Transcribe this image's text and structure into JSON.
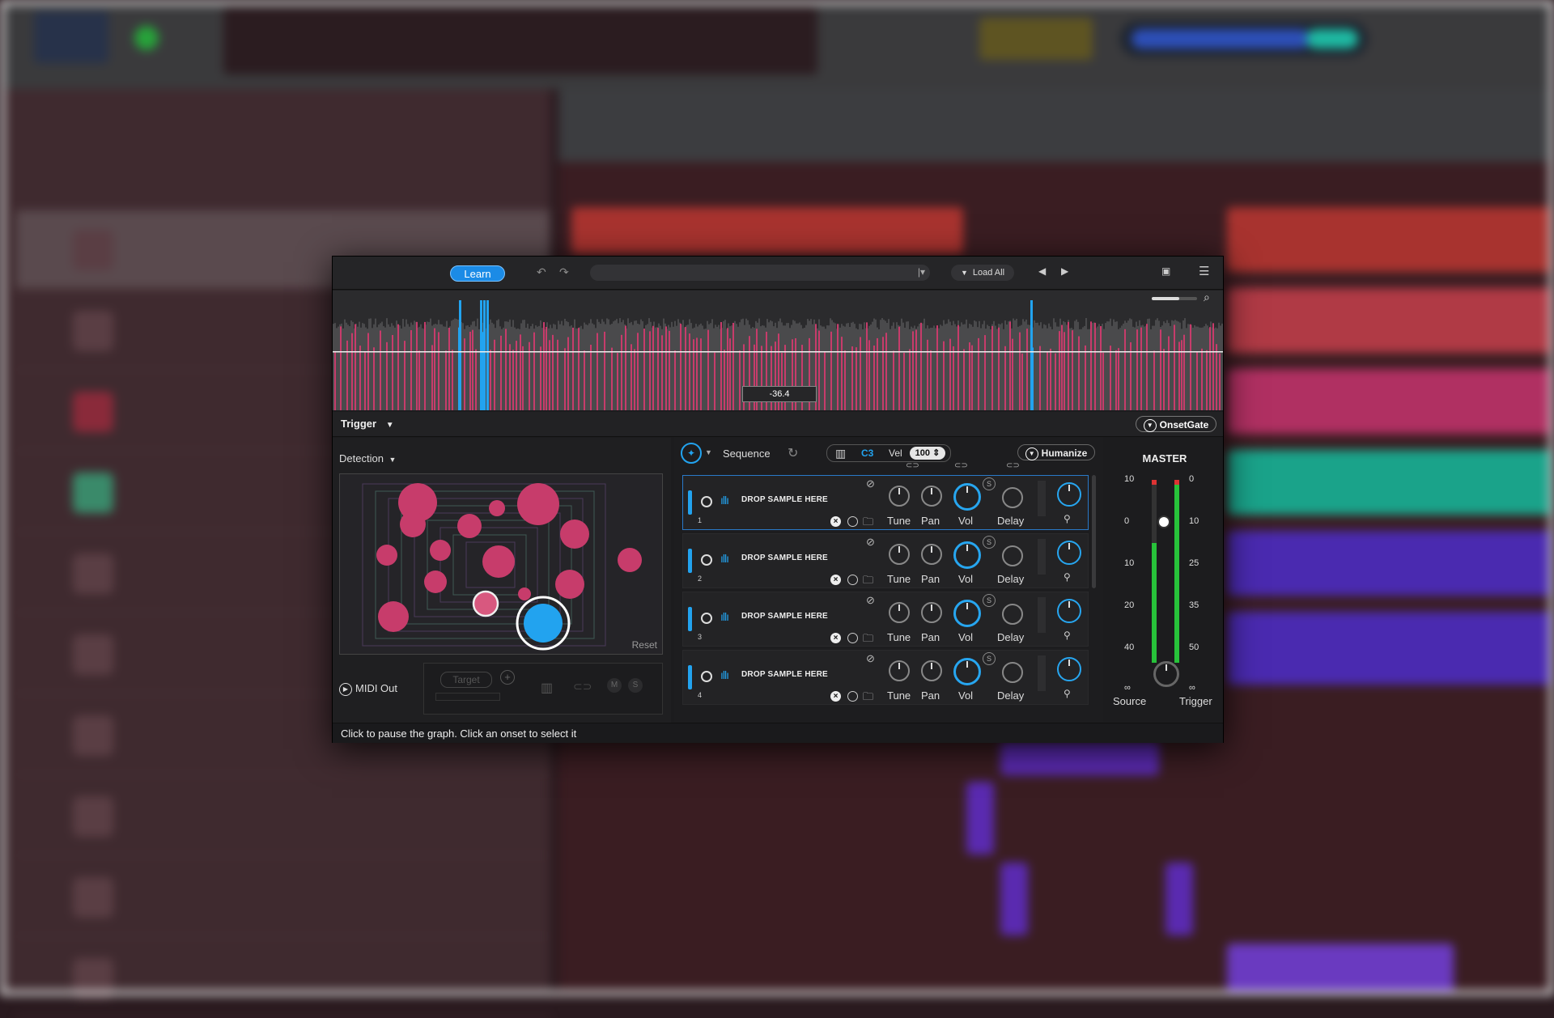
{
  "plugin": {
    "toolbar": {
      "learn_label": "Learn",
      "load_all_label": "Load All"
    },
    "waveform": {
      "threshold_value": "-36.4"
    },
    "trigger": {
      "mode_label": "Trigger",
      "detector_label": "OnsetGate"
    },
    "detection": {
      "label": "Detection",
      "reset_label": "Reset",
      "midi_out_label": "MIDI Out",
      "target_label": "Target",
      "mute_label": "M",
      "solo_label": "S"
    },
    "sequence": {
      "label": "Sequence",
      "note": "C3",
      "vel_label": "Vel",
      "velocity": "100",
      "humanize_label": "Humanize"
    },
    "slots": [
      {
        "number": "1",
        "drop_label": "DROP SAMPLE HERE",
        "tune": "Tune",
        "pan": "Pan",
        "vol": "Vol",
        "delay": "Delay",
        "solo": "S"
      },
      {
        "number": "2",
        "drop_label": "DROP SAMPLE HERE",
        "tune": "Tune",
        "pan": "Pan",
        "vol": "Vol",
        "delay": "Delay",
        "solo": "S"
      },
      {
        "number": "3",
        "drop_label": "DROP SAMPLE HERE",
        "tune": "Tune",
        "pan": "Pan",
        "vol": "Vol",
        "delay": "Delay",
        "solo": "S"
      },
      {
        "number": "4",
        "drop_label": "DROP SAMPLE HERE",
        "tune": "Tune",
        "pan": "Pan",
        "vol": "Vol",
        "delay": "Delay",
        "solo": "S"
      }
    ],
    "master": {
      "title": "MASTER",
      "left_scale": [
        "10",
        "0",
        "10",
        "20",
        "40",
        "∞"
      ],
      "right_scale": [
        "0",
        "10",
        "25",
        "35",
        "50",
        "∞"
      ],
      "source_label": "Source",
      "trigger_label": "Trigger"
    },
    "status_text": "Click to pause the graph. Click an onset to select it"
  },
  "colors": {
    "accent": "#22a3ef",
    "onset_pink": "#c73c6b",
    "meter_green": "#27c23a"
  }
}
